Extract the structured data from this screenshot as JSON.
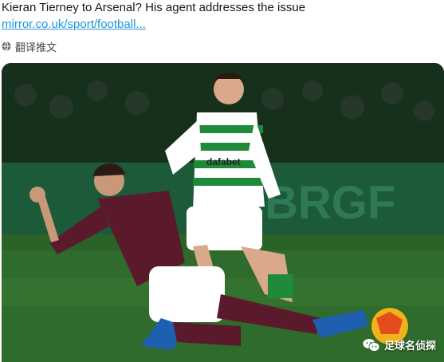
{
  "tweet": {
    "text": "Kieran Tierney to Arsenal? His agent addresses the issue",
    "link": "mirror.co.uk/sport/football...",
    "translate_label": "翻译推文"
  },
  "photo": {
    "board_text": "BRGF",
    "shirt_sponsor": "dafabet",
    "watermark": "足球名侦探"
  },
  "colors": {
    "link": "#1b95e0",
    "pitch": "#2f6b2c",
    "celtic_green": "#1f8a3a",
    "hearts_maroon": "#5a1a2b"
  },
  "icons": {
    "translate": "globe-icon",
    "watermark": "wechat-icon"
  }
}
